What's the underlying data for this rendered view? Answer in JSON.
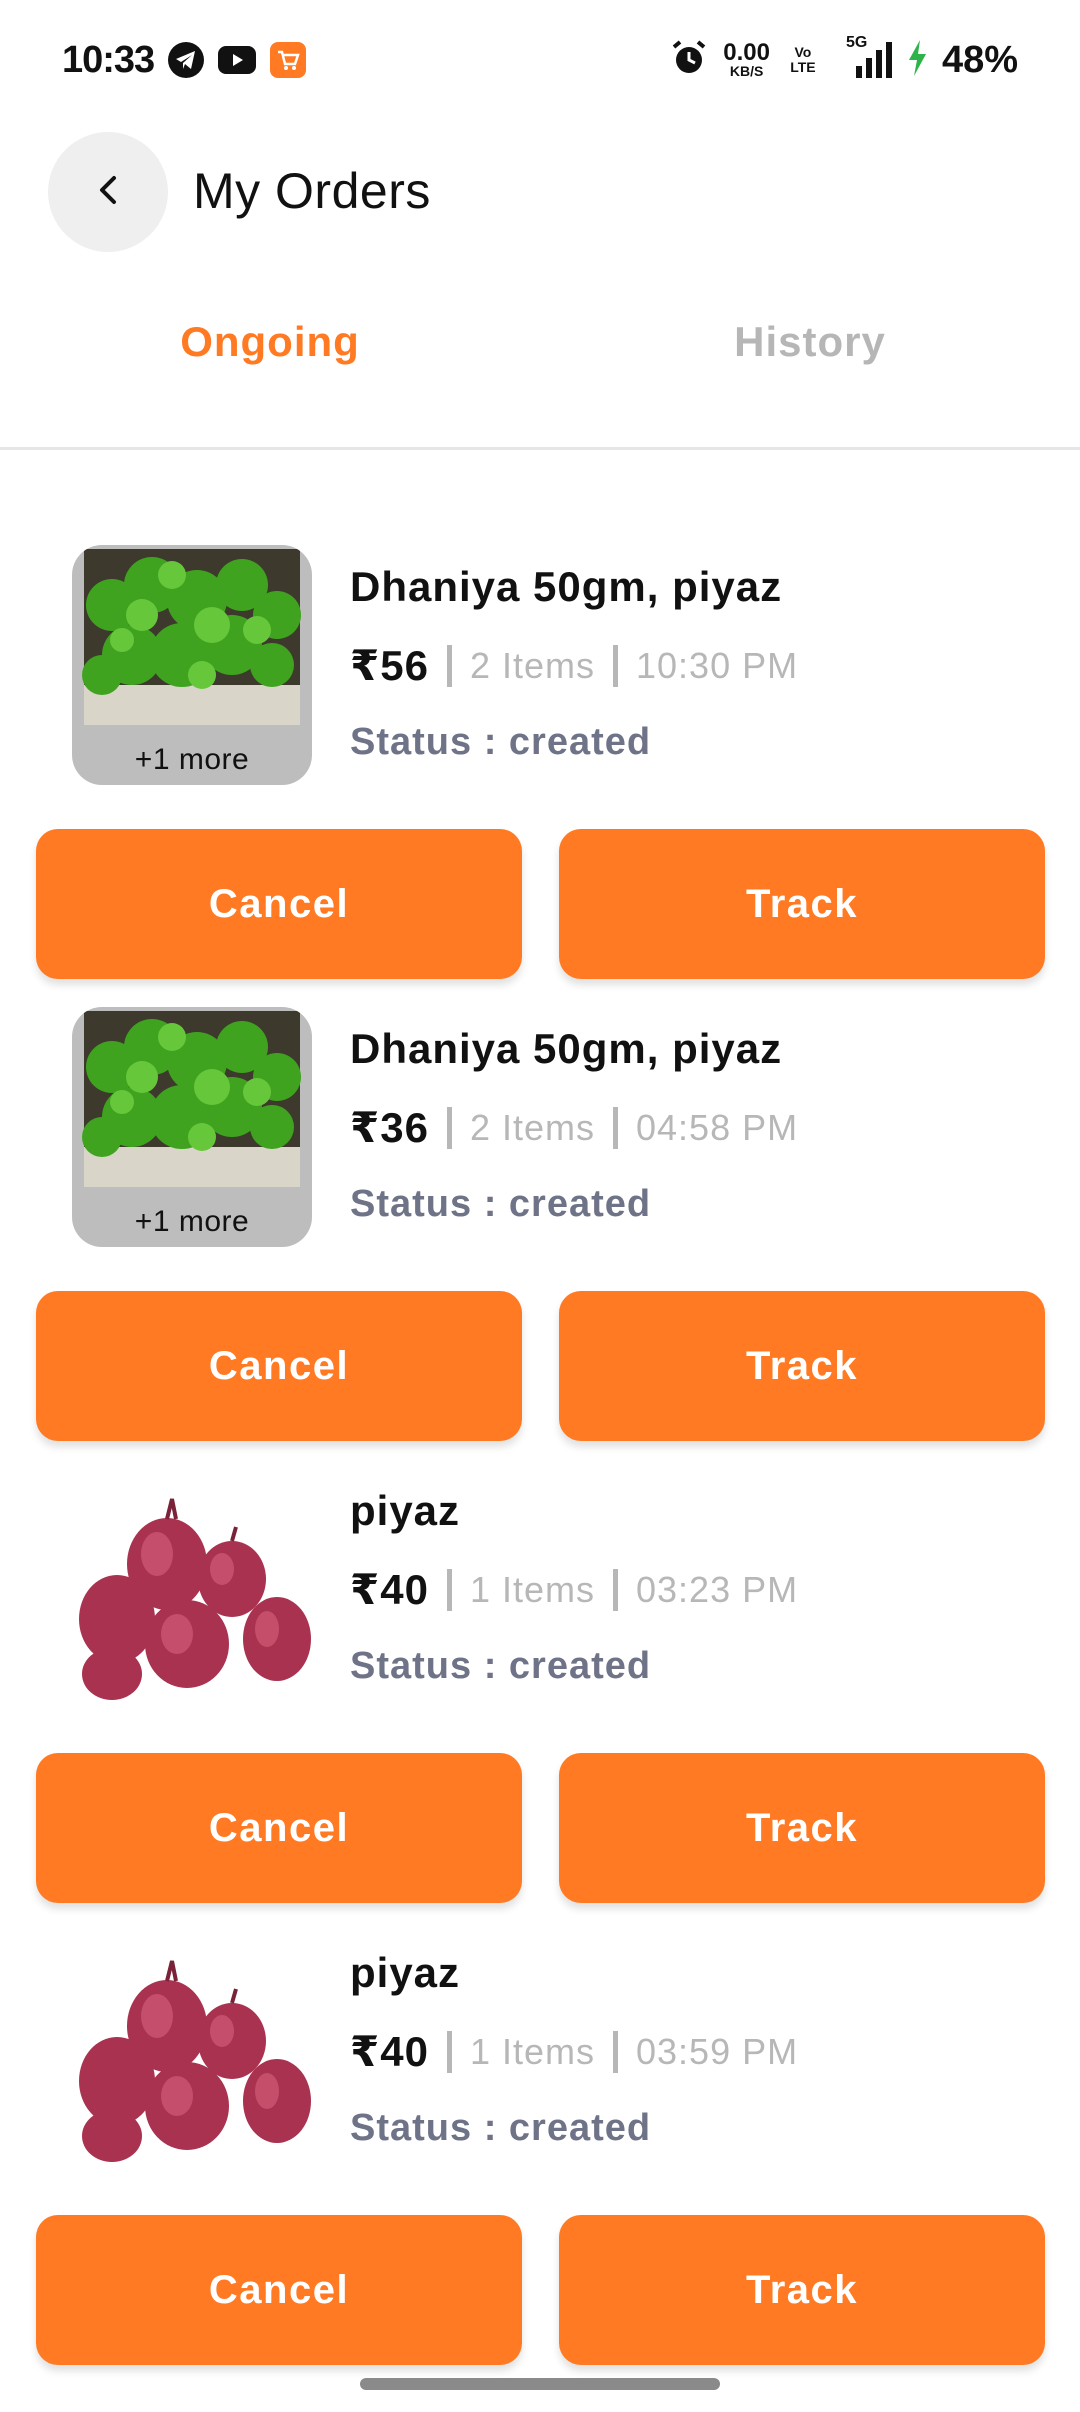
{
  "status_bar": {
    "time": "10:33",
    "net_speed_value": "0.00",
    "net_speed_unit": "KB/S",
    "volte": "Vo LTE",
    "network": "5G",
    "battery": "48%",
    "icons": [
      "telegram-icon",
      "youtube-icon",
      "shop-icon",
      "alarm-icon",
      "signal-icon",
      "charging-icon"
    ]
  },
  "header": {
    "title": "My Orders",
    "back_icon": "chevron-left-icon"
  },
  "tabs": [
    {
      "label": "Ongoing",
      "active": true
    },
    {
      "label": "History",
      "active": false
    }
  ],
  "orders": [
    {
      "title": "Dhaniya 50gm, piyaz",
      "price": "₹56",
      "items": "2 Items",
      "time": "10:30 PM",
      "status": "Status : created",
      "more": "+1 more",
      "image": "coriander",
      "cancel_label": "Cancel",
      "track_label": "Track"
    },
    {
      "title": "Dhaniya 50gm, piyaz",
      "price": "₹36",
      "items": "2 Items",
      "time": "04:58 PM",
      "status": "Status : created",
      "more": "+1 more",
      "image": "coriander",
      "cancel_label": "Cancel",
      "track_label": "Track"
    },
    {
      "title": "piyaz",
      "price": "₹40",
      "items": "1 Items",
      "time": "03:23 PM",
      "status": "Status : created",
      "image": "onion",
      "cancel_label": "Cancel",
      "track_label": "Track"
    },
    {
      "title": "piyaz",
      "price": "₹40",
      "items": "1 Items",
      "time": "03:59 PM",
      "status": "Status : created",
      "image": "onion",
      "cancel_label": "Cancel",
      "track_label": "Track"
    }
  ],
  "colors": {
    "accent": "#ff7a22",
    "muted": "#b7b7b7",
    "status": "#6f7388"
  }
}
